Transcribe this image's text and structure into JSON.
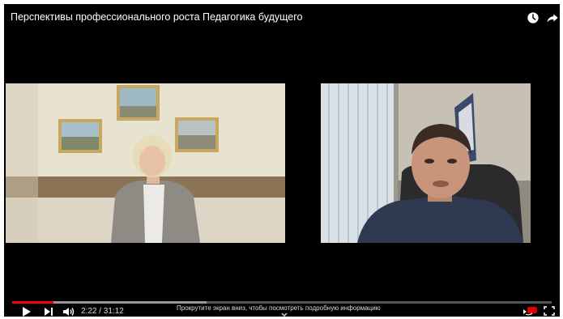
{
  "video": {
    "title": "Перспективы профессионального роста Педагогика будущего",
    "time": "2:22 / 31:12",
    "progress_played": 0.076,
    "progress_buffered": 0.36
  },
  "overlay": {
    "scroll_hint": "Прокрутите экран вниз, чтобы посмотреть подробную информацию"
  },
  "icons": {
    "watch_later": "clock-icon",
    "share": "share-arrow-icon",
    "play": "play-icon",
    "next": "next-icon",
    "volume": "volume-icon",
    "hint_arrow": "chevron-down-icon",
    "autoplay": "autoplay-icon",
    "fullscreen": "fullscreen-icon"
  },
  "colors": {
    "background": "#000000",
    "progress_played": "#ff0000",
    "text": "#ffffff"
  }
}
